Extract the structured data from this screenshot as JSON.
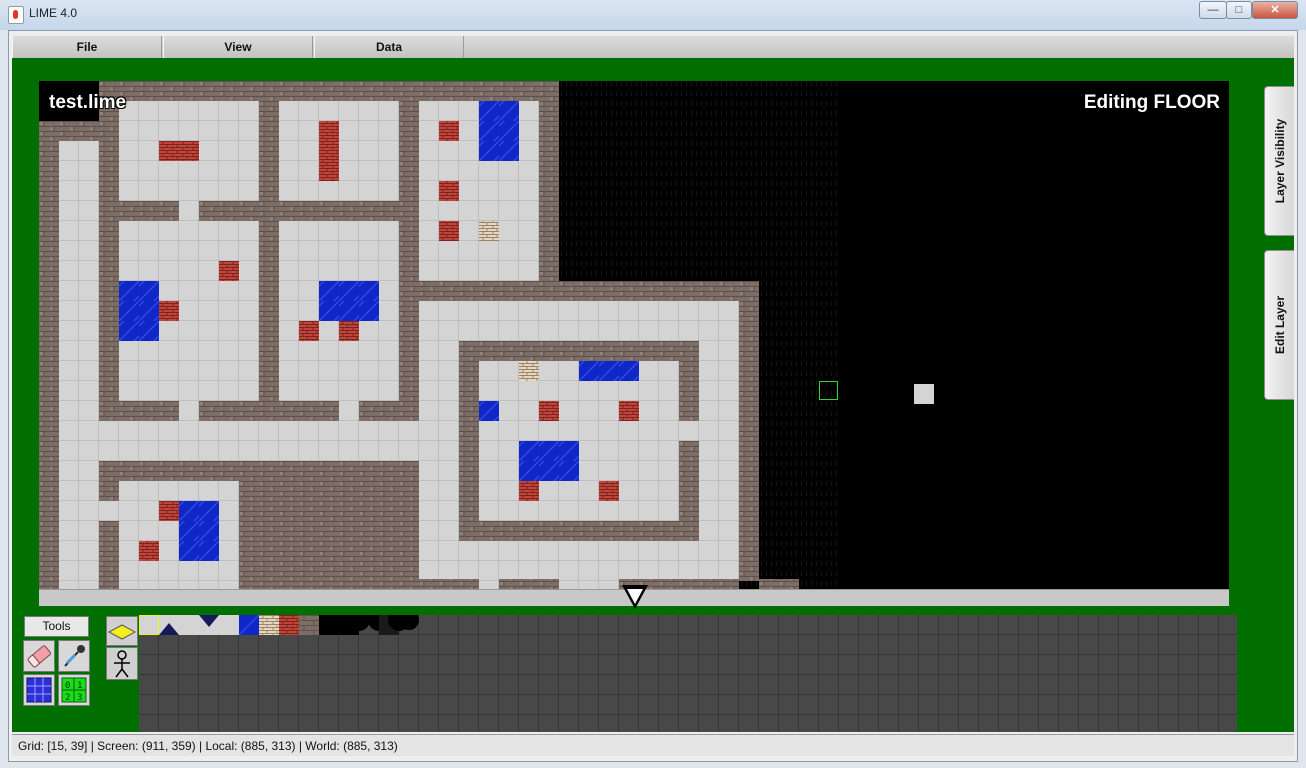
{
  "window": {
    "title": "LIME 4.0",
    "minimize": "—",
    "maximize": "□",
    "close": "✕"
  },
  "menu": [
    {
      "label": "File"
    },
    {
      "label": "View"
    },
    {
      "label": "Data"
    }
  ],
  "map": {
    "file_name": "test.lime",
    "mode": "Editing FLOOR"
  },
  "side_tabs": {
    "layer_visibility": "Layer Visibility",
    "edit_layer": "Edit Layer"
  },
  "tools": {
    "label": "Tools",
    "items": [
      "eraser-icon",
      "eyedropper-icon",
      "grid-icon",
      "tile-numbers-icon"
    ]
  },
  "status": {
    "text": "Grid:  [15, 39]   |   Screen:  (911, 359)   |   Local:  (885, 313)   |   World:  (885, 313)"
  },
  "colors": {
    "workspace": "#006e00",
    "floor": "#d4d4d4",
    "wall": "#7a6b63",
    "water": "#1027c8",
    "crate": "#c2453a",
    "palette_bg": "#484848"
  }
}
